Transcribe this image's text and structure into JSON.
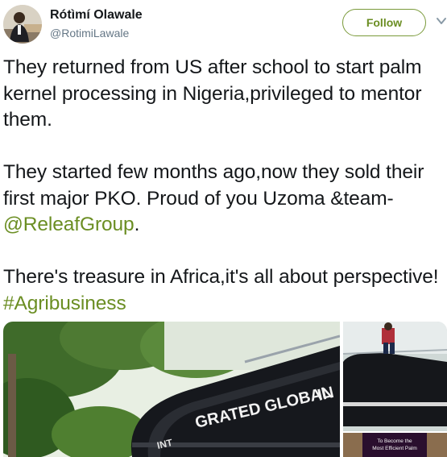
{
  "user": {
    "name": "Rótìmí Olawale",
    "handle": "@RotimiLawale",
    "follow_label": "Follow"
  },
  "tweet": {
    "para1": "They returned from US after school to start palm kernel processing in Nigeria,privileged to mentor them.",
    "para2_text": "They started few months ago,now they sold their first major PKO. Proud of you Uzoma &team- ",
    "mention": "@ReleafGroup",
    "para2_end": ".",
    "para3_text": "There's treasure in Africa,it's all about perspective! ",
    "hashtag": "#Agribusiness"
  },
  "media": {
    "main_tank_text": "GRATED GLOBAL",
    "main_tank_text_left": "INT",
    "main_tank_text_right": "IN",
    "side_bottom_text_1": "To Become the",
    "side_bottom_text_2": "Most Efficient Palm"
  },
  "colors": {
    "accent": "#6b8e23",
    "text": "#14171a",
    "muted": "#657786"
  }
}
